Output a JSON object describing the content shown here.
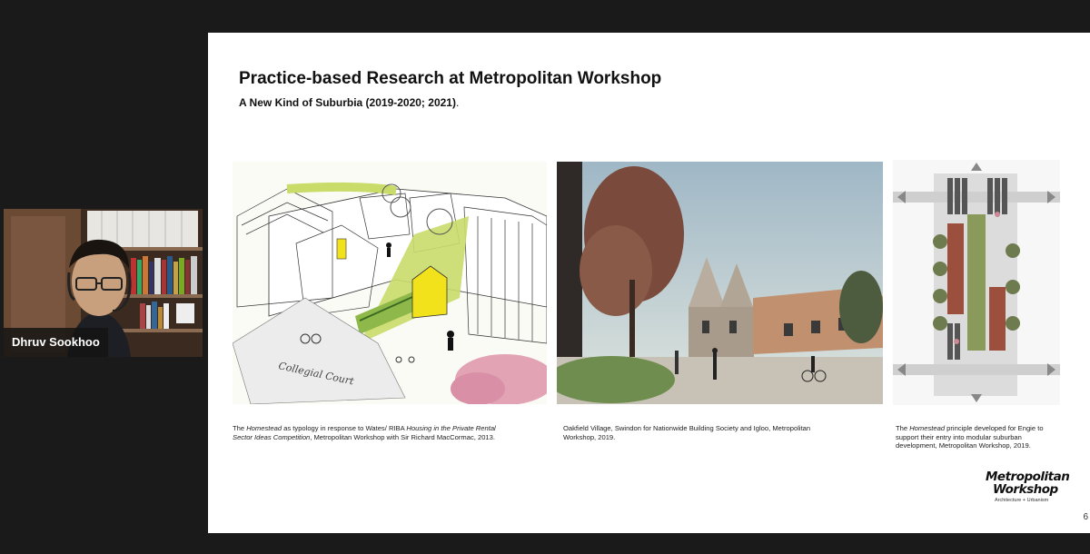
{
  "participant": {
    "name": "Dhruv Sookhoo"
  },
  "slide": {
    "title": "Practice-based Research at Metropolitan Workshop",
    "subtitle": "A New Kind of Suburbia (2019-2020; 2021)",
    "subtitle_end": ".",
    "page_number": "6",
    "captions": {
      "left": {
        "part1": "The ",
        "part2": "Homestead",
        "part3": " as typology in response to Wates/ RIBA ",
        "part4": "Housing in the Private Rental Sector Ideas Competition",
        "part5": ", Metropolitan Workshop with Sir Richard MacCormac, 2013."
      },
      "middle": "Oakfield Village, Swindon for Nationwide Building Society and Igloo, Metropolitan Workshop, 2019.",
      "right": {
        "part1": "The ",
        "part2": "Homestead",
        "part3": " principle developed for Engie to support their entry into modular suburban development, Metropolitan Workshop, 2019."
      }
    },
    "sketch_annotation": "Collegial Court",
    "logo": {
      "line1": "Metropolitan",
      "line2": "Workshop",
      "tagline": "Architecture + Urbanism"
    }
  },
  "colors": {
    "meeting_bg": "#1a1a1a",
    "slide_bg": "#ffffff",
    "sketch_green": "#c9dc6a",
    "sketch_yellow": "#f2e21c"
  }
}
